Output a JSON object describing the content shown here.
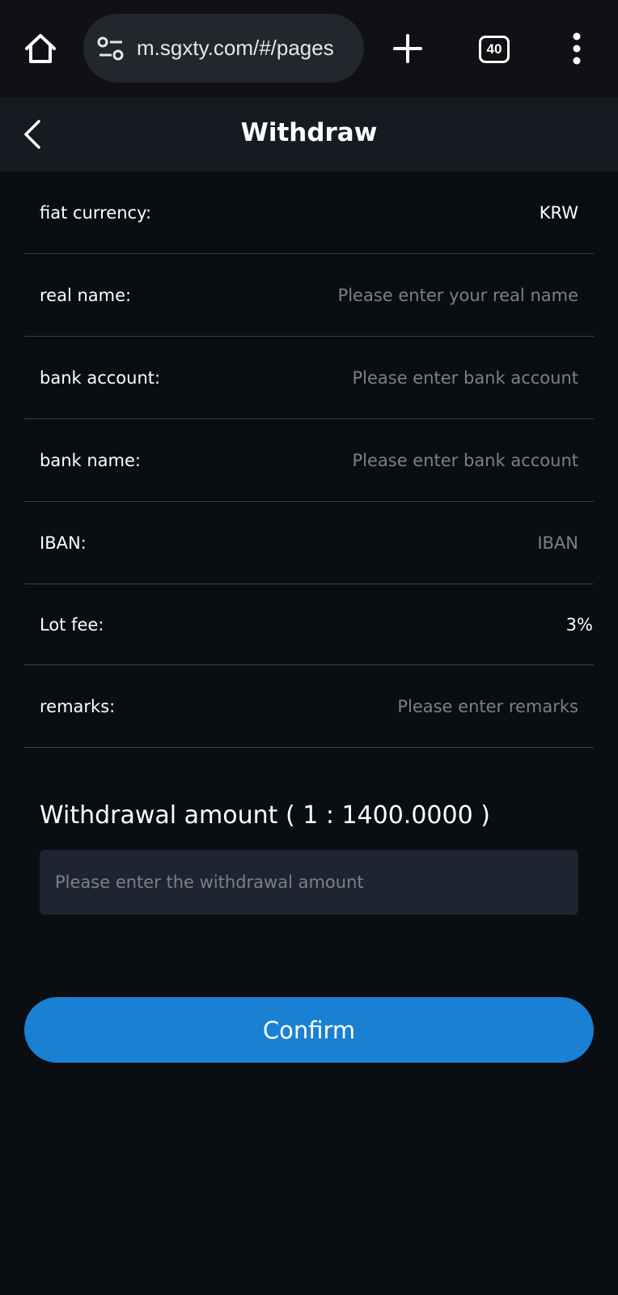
{
  "browser": {
    "url": "m.sgxty.com/#/pages",
    "tab_count": "40"
  },
  "header": {
    "title": "Withdraw"
  },
  "form": {
    "fiat_currency": {
      "label": "fiat currency:",
      "value": "KRW"
    },
    "real_name": {
      "label": "real name:",
      "placeholder": "Please enter your real name"
    },
    "bank_account": {
      "label": "bank account:",
      "placeholder": "Please enter bank account"
    },
    "bank_name": {
      "label": "bank name:",
      "placeholder": "Please enter bank account"
    },
    "iban": {
      "label": "IBAN:",
      "placeholder": "IBAN"
    },
    "lot_fee": {
      "label": "Lot fee:",
      "value": "3%"
    },
    "remarks": {
      "label": "remarks:",
      "placeholder": "Please enter remarks"
    }
  },
  "amount": {
    "label": "Withdrawal amount ( 1 : 1400.0000 )",
    "placeholder": "Please enter the withdrawal amount"
  },
  "actions": {
    "confirm_label": "Confirm"
  },
  "colors": {
    "background": "#0a0d11",
    "header_bg": "#161b22",
    "input_bg": "#1e2530",
    "accent": "#1a80d4",
    "placeholder": "#7c8087",
    "divider": "#3a3f48"
  }
}
